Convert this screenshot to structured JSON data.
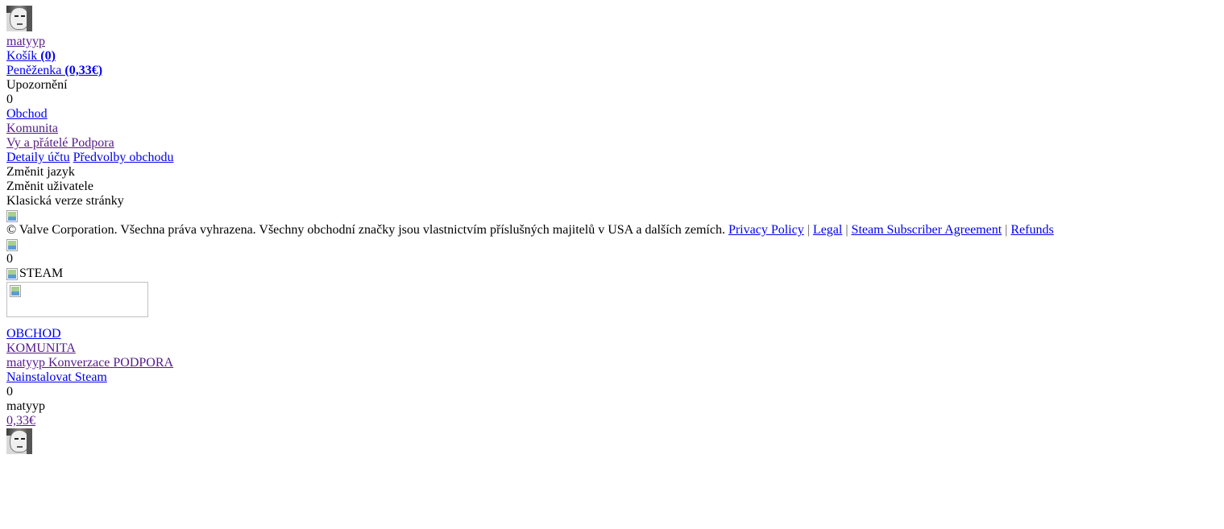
{
  "header": {
    "username": "matyyp",
    "cart_label": "Košík ",
    "cart_count": "(0)",
    "wallet_label": "Peněženka ",
    "wallet_amount": "(0,33€)",
    "notifications_label": "Upozornění",
    "notifications_count": "0"
  },
  "menu": {
    "store": "Obchod",
    "community": "Komunita",
    "you_and_friends": "Vy a přátelé",
    "support": "Podpora",
    "account_details": "Detaily účtu",
    "store_preferences": "Předvolby obchodu",
    "change_language": "Změnit jazyk",
    "change_user": "Změnit uživatele",
    "classic_version": "Klasická verze stránky"
  },
  "footer": {
    "copyright": "© Valve Corporation. Všechna práva vyhrazena. Všechny obchodní značky jsou vlastnictvím příslušných majitelů v USA a dalších zemích.",
    "privacy": "Privacy Policy",
    "legal": "Legal",
    "ssa": "Steam Subscriber Agreement",
    "refunds": "Refunds",
    "separator": "|"
  },
  "mobile": {
    "notification_count": "0",
    "logo_alt": "STEAM",
    "store_nav": "OBCHOD",
    "community_nav": "KOMUNITA",
    "username": "matyyp",
    "conversations": "Konverzace",
    "support_nav": "PODPORA",
    "install_steam": "Nainstalovat Steam",
    "count_badge": "0",
    "profile_name": "matyyp",
    "wallet_balance": "0,33€"
  },
  "icons": {
    "avatar": "user-avatar-icon",
    "broken_image": "broken-image-icon"
  },
  "colors": {
    "link": "#0000ee",
    "visited_link": "#551a8b",
    "text": "#000000",
    "background": "#ffffff"
  }
}
